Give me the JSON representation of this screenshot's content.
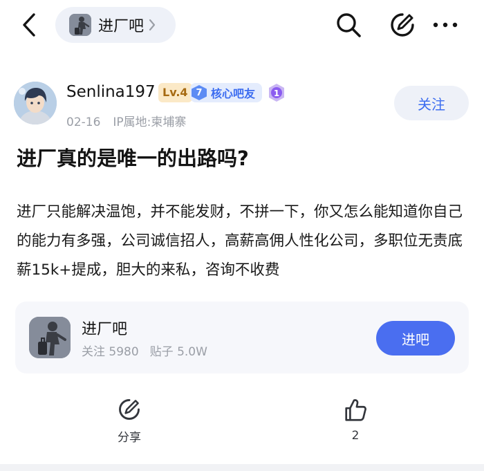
{
  "header": {
    "forum_name": "进厂吧",
    "icons": {
      "back": "back-arrow-icon",
      "search": "search-icon",
      "edit": "edit-icon",
      "more": "more-icon",
      "chevron": "chevron-right-icon"
    }
  },
  "post": {
    "author": {
      "username": "Senlina197",
      "level_badge": "Lv.4",
      "core_level": "7",
      "core_label": "核心吧友",
      "medal_number": "1"
    },
    "date": "02-16",
    "ip_location": "IP属地:柬埔寨",
    "follow_label": "关注",
    "title": "进厂真的是唯一的出路吗?",
    "body": "进厂只能解决温饱，并不能发财，不拼一下，你又怎么能知道你自己的能力有多强，公司诚信招人，高薪高佣人性化公司，多职位无责底薪15k+提成，胆大的来私，咨询不收费"
  },
  "forum_card": {
    "name": "进厂吧",
    "followers": "关注 5980",
    "posts": "贴子 5.0W",
    "enter_label": "进吧"
  },
  "actions": {
    "share_label": "分享",
    "like_count": "2"
  },
  "colors": {
    "accent": "#4a6ef0",
    "pill_bg": "#eef1f8",
    "muted_text": "#9a9ea6",
    "level_badge_bg": "#fbe9c7"
  }
}
